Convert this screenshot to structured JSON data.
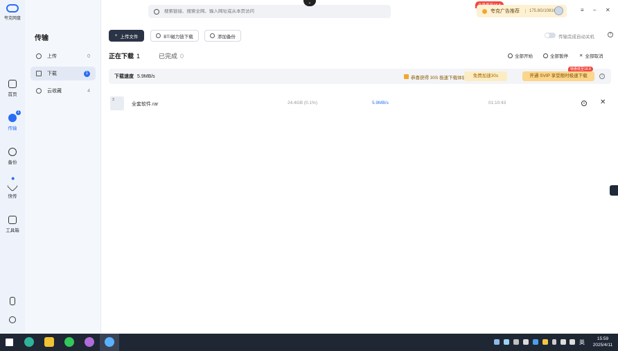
{
  "app": {
    "logo_name": "夸克网盘",
    "search": {
      "placeholder": "搜索链接、搜索全网、输入网址或从本页访问"
    },
    "promo": {
      "tag": "会员低至18.8",
      "text": "夸克广告推荐",
      "storage": "175.8G/1081G"
    }
  },
  "rail": {
    "items": [
      {
        "label": "首页",
        "icon": "home-icon"
      },
      {
        "label": "传输",
        "icon": "transfer-icon",
        "badge": "1"
      },
      {
        "label": "备份",
        "icon": "backup-icon"
      },
      {
        "label": "快传",
        "icon": "quick-send-icon"
      },
      {
        "label": "工具箱",
        "icon": "toolbox-icon"
      }
    ]
  },
  "sidebar": {
    "title": "传输",
    "items": [
      {
        "label": "上传",
        "count": "0"
      },
      {
        "label": "下载",
        "count": "1"
      },
      {
        "label": "云收藏",
        "count": "4"
      }
    ]
  },
  "toolbar": {
    "upload_label": "上传文件",
    "bt_label": "BT/磁力链下载",
    "backup_label": "添加备份",
    "toggle_label": "传输完成自动关机"
  },
  "tabs": {
    "downloading": {
      "label": "正在下载",
      "count": "1"
    },
    "completed": {
      "label": "已完成",
      "count": "0"
    }
  },
  "actions": {
    "start_all": "全部开始",
    "pause_all": "全部暂停",
    "cancel_all": "全部取消"
  },
  "speedbar": {
    "label": "下载速度",
    "value": "5.9MB/s",
    "boost_text": "恭喜获得 30S 极速下载体验券",
    "boost_btn": "免费加速30s",
    "svip_btn": "开通 SVIP 享受限时极速下载",
    "svip_tag": "特惠低至18.8"
  },
  "file": {
    "icon_text": "3",
    "name": "全套软件.rar",
    "size": "24.4GB (0.1%)",
    "speed": "5.9MB/s",
    "time": "01:10:43"
  },
  "taskbar": {
    "lang": "英",
    "time": "15:59",
    "date": "2025/4/11"
  }
}
